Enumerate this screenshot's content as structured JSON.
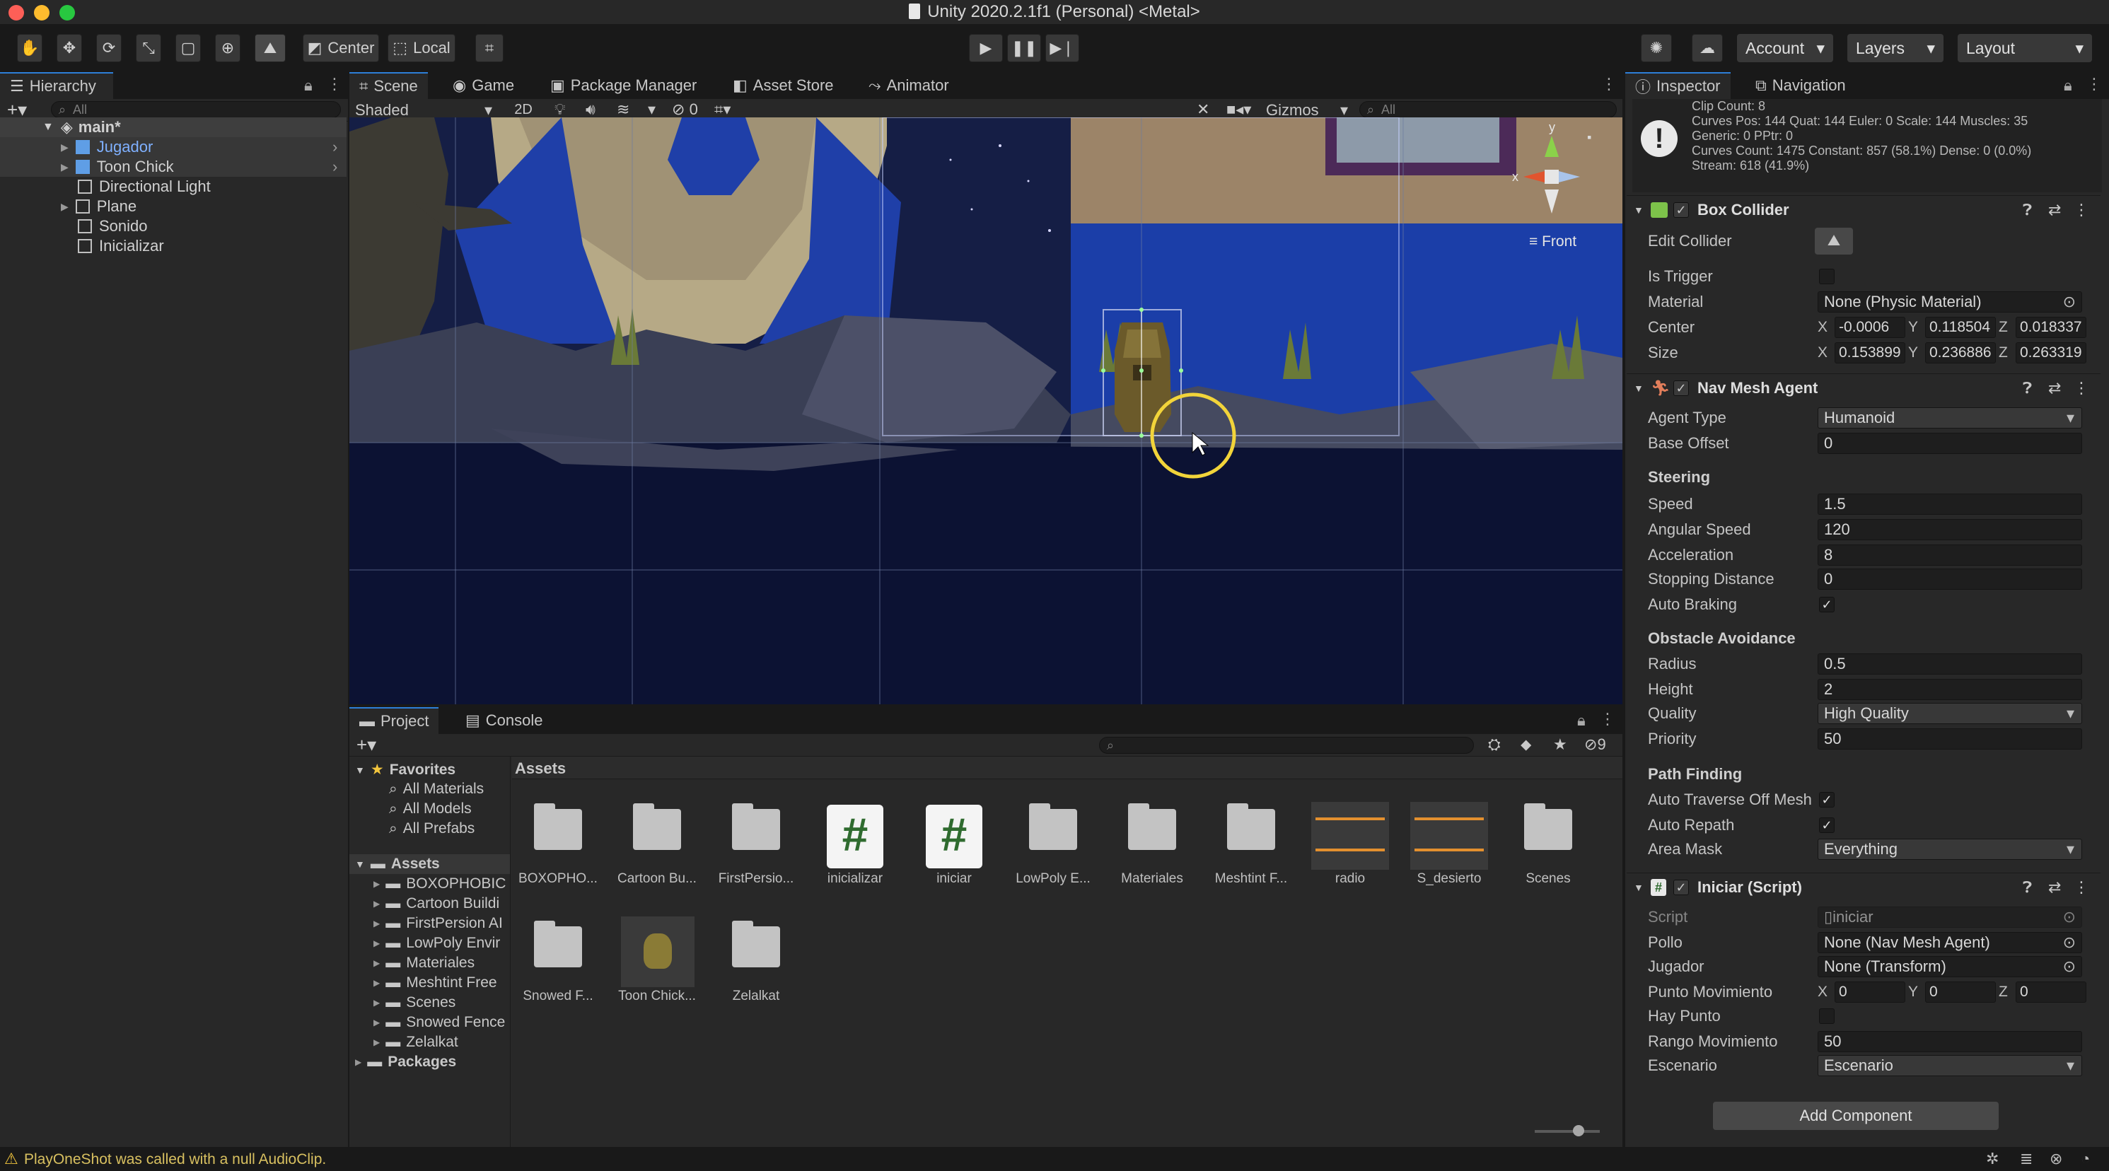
{
  "window": {
    "title": "Unity 2020.2.1f1 (Personal) <Metal>"
  },
  "toolbar": {
    "center_label": "Center",
    "local_label": "Local",
    "account_label": "Account",
    "layers_label": "Layers",
    "layout_label": "Layout"
  },
  "hierarchy": {
    "tab_label": "Hierarchy",
    "search_placeholder": "All",
    "scene_name": "main*",
    "items": [
      {
        "label": "Jugador"
      },
      {
        "label": "Toon Chick"
      },
      {
        "label": "Directional Light"
      },
      {
        "label": "Plane"
      },
      {
        "label": "Sonido"
      },
      {
        "label": "Inicializar"
      }
    ]
  },
  "scene": {
    "tabs": [
      {
        "label": "Scene"
      },
      {
        "label": "Game"
      },
      {
        "label": "Package Manager"
      },
      {
        "label": "Asset Store"
      },
      {
        "label": "Animator"
      }
    ],
    "shading_mode": "Shaded",
    "mode_2d": "2D",
    "hidden_count": "0",
    "gizmos_label": "Gizmos",
    "search_placeholder": "All",
    "view_label": "Front"
  },
  "project": {
    "tabs": [
      {
        "label": "Project"
      },
      {
        "label": "Console"
      }
    ],
    "hidden_count": "9",
    "favorites_label": "Favorites",
    "favorites": [
      {
        "label": "All Materials"
      },
      {
        "label": "All Models"
      },
      {
        "label": "All Prefabs"
      }
    ],
    "assets_label": "Assets",
    "asset_folders": [
      {
        "label": "BOXOPHOBIC"
      },
      {
        "label": "Cartoon Buildi"
      },
      {
        "label": "FirstPersion AI"
      },
      {
        "label": "LowPoly Envir"
      },
      {
        "label": "Materiales"
      },
      {
        "label": "Meshtint Free"
      },
      {
        "label": "Scenes"
      },
      {
        "label": "Snowed Fence"
      },
      {
        "label": "Zelalkat"
      }
    ],
    "packages_label": "Packages",
    "grid_header": "Assets",
    "grid": [
      {
        "label": "BOXOPHO...",
        "kind": "folder"
      },
      {
        "label": "Cartoon Bu...",
        "kind": "folder"
      },
      {
        "label": "FirstPersio...",
        "kind": "folder"
      },
      {
        "label": "inicializar",
        "kind": "script"
      },
      {
        "label": "iniciar",
        "kind": "script"
      },
      {
        "label": "LowPoly E...",
        "kind": "folder"
      },
      {
        "label": "Materiales",
        "kind": "folder"
      },
      {
        "label": "Meshtint F...",
        "kind": "folder"
      },
      {
        "label": "radio",
        "kind": "audio"
      },
      {
        "label": "S_desierto",
        "kind": "audio"
      },
      {
        "label": "Scenes",
        "kind": "folder"
      },
      {
        "label": "Snowed F...",
        "kind": "folder"
      },
      {
        "label": "Toon Chick...",
        "kind": "model"
      },
      {
        "label": "Zelalkat",
        "kind": "folder"
      }
    ]
  },
  "inspector": {
    "tabs": [
      {
        "label": "Inspector"
      },
      {
        "label": "Navigation"
      }
    ],
    "anim_info": [
      "Clip Count: 8",
      "Curves Pos: 144 Quat: 144 Euler: 0 Scale: 144 Muscles: 35",
      "Generic: 0 PPtr: 0",
      "Curves Count: 1475 Constant: 857 (58.1%) Dense: 0 (0.0%)",
      "Stream: 618 (41.9%)"
    ],
    "box_collider": {
      "title": "Box Collider",
      "edit_collider": "Edit Collider",
      "is_trigger": "Is Trigger",
      "material_label": "Material",
      "material_value": "None (Physic Material)",
      "center_label": "Center",
      "center": {
        "x": "-0.0006",
        "y": "0.118504",
        "z": "0.018337"
      },
      "size_label": "Size",
      "size": {
        "x": "0.153899",
        "y": "0.236886",
        "z": "0.263319"
      }
    },
    "nav_mesh_agent": {
      "title": "Nav Mesh Agent",
      "agent_type_label": "Agent Type",
      "agent_type": "Humanoid",
      "base_offset_label": "Base Offset",
      "base_offset": "0",
      "steering_label": "Steering",
      "speed_label": "Speed",
      "speed": "1.5",
      "angular_speed_label": "Angular Speed",
      "angular_speed": "120",
      "acceleration_label": "Acceleration",
      "acceleration": "8",
      "stopping_distance_label": "Stopping Distance",
      "stopping_distance": "0",
      "auto_braking_label": "Auto Braking",
      "obstacle_label": "Obstacle Avoidance",
      "radius_label": "Radius",
      "radius": "0.5",
      "height_label": "Height",
      "height": "2",
      "quality_label": "Quality",
      "quality": "High Quality",
      "priority_label": "Priority",
      "priority": "50",
      "path_finding_label": "Path Finding",
      "auto_traverse_label": "Auto Traverse Off Mesh",
      "auto_repath_label": "Auto Repath",
      "area_mask_label": "Area Mask",
      "area_mask": "Everything"
    },
    "iniciar_script": {
      "title": "Iniciar (Script)",
      "script_label": "Script",
      "script_value": "iniciar",
      "pollo_label": "Pollo",
      "pollo_value": "None (Nav Mesh Agent)",
      "jugador_label": "Jugador",
      "jugador_value": "None (Transform)",
      "punto_label": "Punto Movimiento",
      "punto": {
        "x": "0",
        "y": "0",
        "z": "0"
      },
      "hay_punto_label": "Hay Punto",
      "rango_label": "Rango Movimiento",
      "rango": "50",
      "escenario_label": "Escenario",
      "escenario": "Escenario"
    },
    "add_component_label": "Add Component"
  },
  "status": {
    "message": "PlayOneShot was called with a null AudioClip."
  },
  "colors": {
    "accent": "#2d7fd8",
    "selection": "#2c5d87",
    "warning": "#f2c53d"
  }
}
